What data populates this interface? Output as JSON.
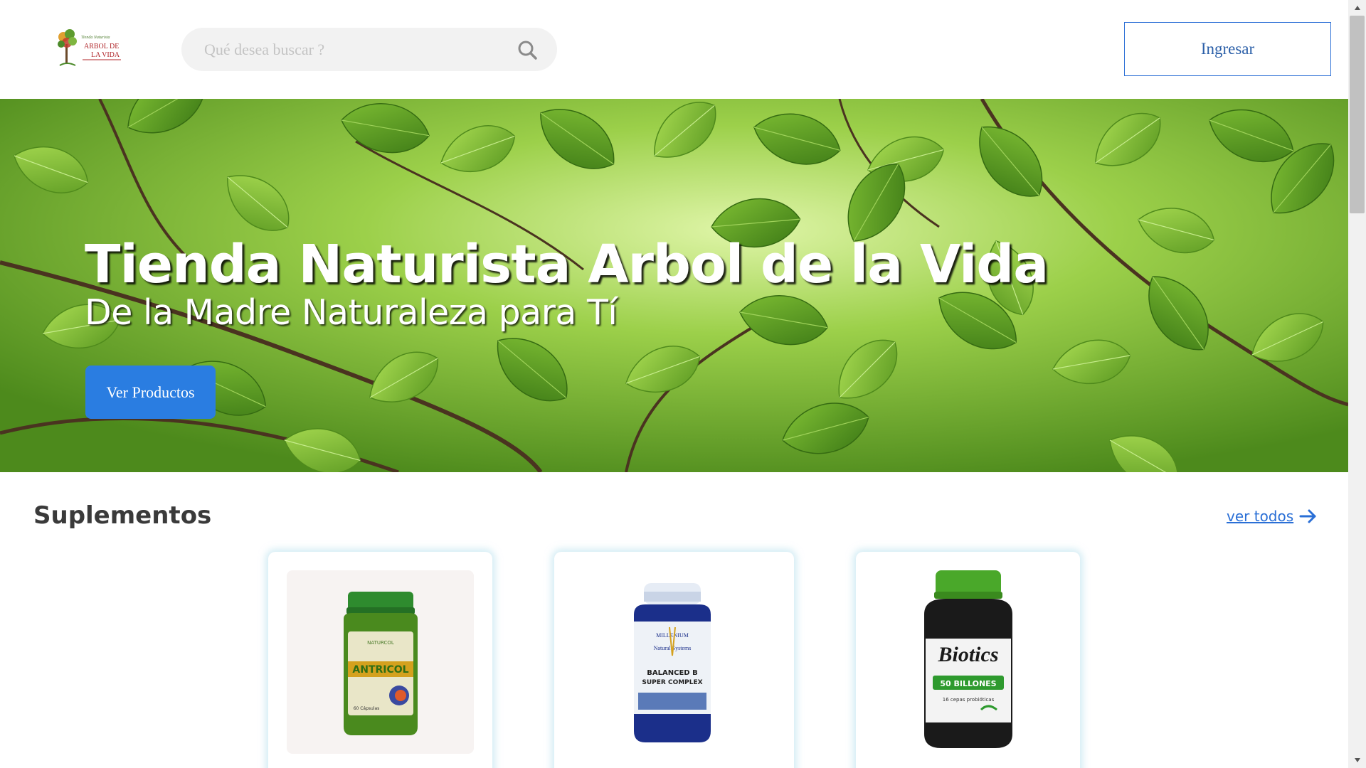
{
  "header": {
    "logo_alt": "Tienda Naturista Arbol de la Vida",
    "logo_text_top": "Tienda Naturista",
    "logo_text_main": "ARBOL DE",
    "logo_text_sub": "LA VIDA",
    "search_placeholder": "Qué desea buscar ?",
    "login_label": "Ingresar"
  },
  "hero": {
    "title": "Tienda Naturista Arbol de la Vida",
    "subtitle": "De la Madre Naturaleza para Tí",
    "cta_label": "Ver Productos"
  },
  "section": {
    "title": "Suplementos",
    "see_all_label": "ver todos"
  },
  "products": [
    {
      "label_main": "ANTRICOL",
      "brand": "NATURCOL",
      "count": "60 Cápsulas"
    },
    {
      "label_main": "BALANCED B",
      "label_sub": "SUPER COMPLEX",
      "brand_top": "MILLENIUM",
      "brand": "Natural Systems"
    },
    {
      "label_main": "Biotics",
      "label_band": "50 BILLONES",
      "label_sub": "16 cepas probióticas"
    }
  ],
  "colors": {
    "accent": "#2a7de1",
    "link": "#2a6fd6",
    "hero_green": "#6fa82a"
  }
}
